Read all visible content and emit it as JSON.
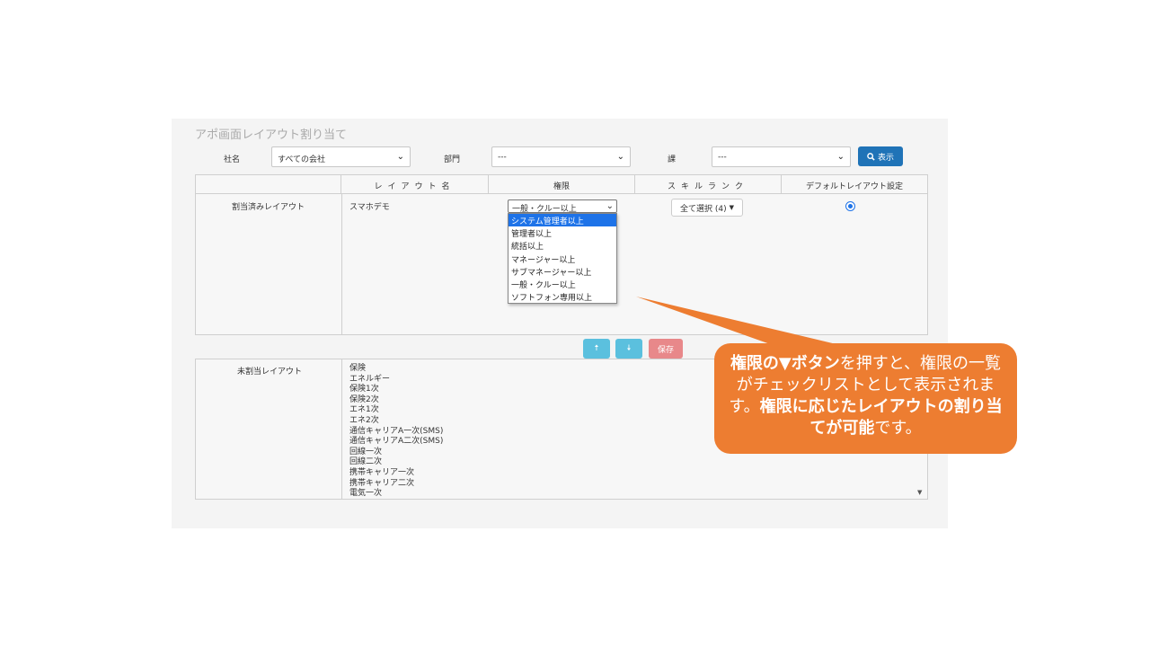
{
  "page": {
    "title": "アポ画面レイアウト割り当て"
  },
  "filters": {
    "company_label": "社名",
    "company_value": "すべての会社",
    "department_label": "部門",
    "department_value": "---",
    "section_label": "課",
    "section_value": "---",
    "show_button": "表示"
  },
  "table": {
    "headers": [
      "レイアウト名",
      "権限",
      "スキルランク",
      "デフォルトレイアウト設定"
    ],
    "assigned_label": "割当済みレイアウト",
    "assigned_layout_name": "スマホデモ",
    "permission_selected": "一般・クルー以上",
    "permission_options": [
      "システム管理者以上",
      "管理者以上",
      "統括以上",
      "マネージャー以上",
      "サブマネージャー以上",
      "一般・クルー以上",
      "ソフトフォン専用以上"
    ],
    "permission_highlighted": "システム管理者以上",
    "skill_button": "全て選択 (4)",
    "default_radio_checked": true
  },
  "actions": {
    "up_icon": "arrow-up-icon",
    "down_icon": "arrow-down-icon",
    "save_label": "保存",
    "up_color": "#5bc0de",
    "save_color": "#e8888a"
  },
  "unassigned": {
    "label": "未割当レイアウト",
    "items": [
      "保険",
      "エネルギー",
      "保険1次",
      "保険2次",
      "エネ1次",
      "エネ2次",
      "通信キャリアA一次(SMS)",
      "通信キャリアA二次(SMS)",
      "回線一次",
      "回線二次",
      "携帯キャリア一次",
      "携帯キャリア二次",
      "電気一次"
    ]
  },
  "callout": {
    "part1_bold": "権限の▼ボタン",
    "part2": "を押すと、権限の一覧がチェックリストとして表示されます。",
    "part3_bold": "権限に応じたレイアウトの割り当てが可能",
    "part4": "です。",
    "color": "#ed7d31"
  }
}
